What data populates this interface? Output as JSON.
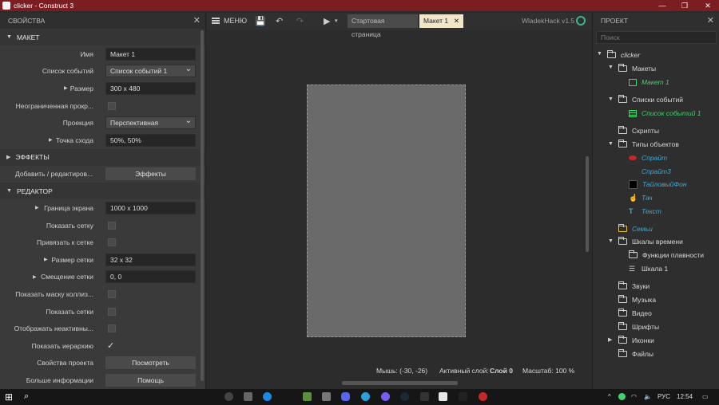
{
  "window": {
    "title": "clicker - Construct 3",
    "minimize": "—",
    "maximize": "❐",
    "close": "✕"
  },
  "left_panel": {
    "title": "СВОЙСТВА",
    "sections": {
      "layout": "МАКЕТ",
      "effects": "ЭФФЕКТЫ",
      "editor": "РЕДАКТОР"
    },
    "layout_props": [
      {
        "label": "Имя",
        "value": "Макет 1"
      },
      {
        "label": "Список событий",
        "value": "Список событий 1"
      },
      {
        "label": "Размер",
        "value": "300 x 480"
      },
      {
        "label": "Неограниченная прокр...",
        "checked": false
      },
      {
        "label": "Проекция",
        "value": "Перспективная"
      },
      {
        "label": "Точка схода",
        "value": "50%,  50%"
      }
    ],
    "effects_row": {
      "label": "Добавить / редактиров...",
      "button": "Эффекты"
    },
    "editor_props": [
      {
        "label": "Граница экрана",
        "value": "1000 x 1000"
      },
      {
        "label": "Показать сетку",
        "checked": false
      },
      {
        "label": "Привязать к сетке",
        "checked": false
      },
      {
        "label": "Размер сетки",
        "value": "32 x 32"
      },
      {
        "label": "Смещение сетки",
        "value": "0,  0"
      },
      {
        "label": "Показать маску коллиз...",
        "checked": false
      },
      {
        "label": "Показать сетки",
        "checked": false
      },
      {
        "label": "Отображать неактивны...",
        "checked": false
      },
      {
        "label": "Показать иерархию",
        "checked": true
      },
      {
        "label": "Свойства проекта",
        "button": "Посмотреть"
      },
      {
        "label": "Больше информации",
        "button": "Помощь"
      }
    ]
  },
  "toolbar": {
    "menu_label": "МЕНЮ",
    "tabs": [
      {
        "label": "Стартовая страница"
      },
      {
        "label": "Макет 1"
      }
    ],
    "wladek": "WladekHack v1.5"
  },
  "statusbar": {
    "mouse": "Мышь: (-30, -26)",
    "layer_label": "Активный слой:",
    "layer_value": "Слой 0",
    "zoom": "Масштаб: 100 %"
  },
  "right_panel": {
    "title": "ПРОЕКТ",
    "search_placeholder": "Поиск",
    "tree": {
      "root": "clicker",
      "layouts": "Макеты",
      "layout1": "Макет 1",
      "eventsheets": "Списки событий",
      "eventsheet1": "Список событий 1",
      "scripts": "Скрипты",
      "objecttypes": "Типы объектов",
      "sprite": "Спрайт",
      "sprite3": "Спрайт3",
      "tiledbg": "ТайловыйФон",
      "touch": "Тач",
      "text": "Текст",
      "families": "Семьи",
      "timelines": "Шкалы времени",
      "easing": "Функции плавности",
      "timeline1": "Шкала 1",
      "sounds": "Звуки",
      "music": "Музыка",
      "video": "Видео",
      "fonts": "Шрифты",
      "icons": "Иконки",
      "files": "Файлы"
    }
  },
  "taskbar": {
    "lang": "РУС",
    "time": "12:54"
  },
  "colors": {
    "titlebar": "#7c1d22",
    "accent_green": "#3fd36b",
    "accent_blue": "#3fa8d6"
  }
}
